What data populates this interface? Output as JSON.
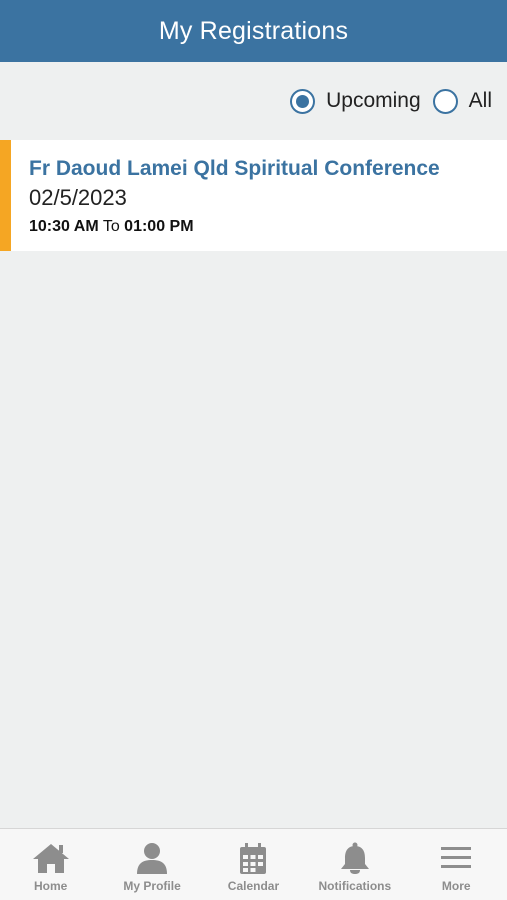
{
  "header": {
    "title": "My Registrations"
  },
  "filter": {
    "options": [
      {
        "label": "Upcoming",
        "selected": true
      },
      {
        "label": "All",
        "selected": false
      }
    ]
  },
  "events": [
    {
      "title": "Fr Daoud Lamei Qld Spiritual Conference",
      "date": "02/5/2023",
      "start_time": "10:30 AM",
      "separator": "To",
      "end_time": "01:00 PM"
    }
  ],
  "bottom_nav": {
    "items": [
      {
        "label": "Home",
        "icon": "home-icon"
      },
      {
        "label": "My Profile",
        "icon": "person-icon"
      },
      {
        "label": "Calendar",
        "icon": "calendar-icon"
      },
      {
        "label": "Notifications",
        "icon": "bell-icon"
      },
      {
        "label": "More",
        "icon": "menu-icon"
      }
    ]
  },
  "colors": {
    "header_bg": "#3b73a1",
    "accent_bar": "#f5a623",
    "title_text": "#3b73a1",
    "page_bg": "#eef0f0",
    "nav_icon": "#8d8d8d"
  }
}
